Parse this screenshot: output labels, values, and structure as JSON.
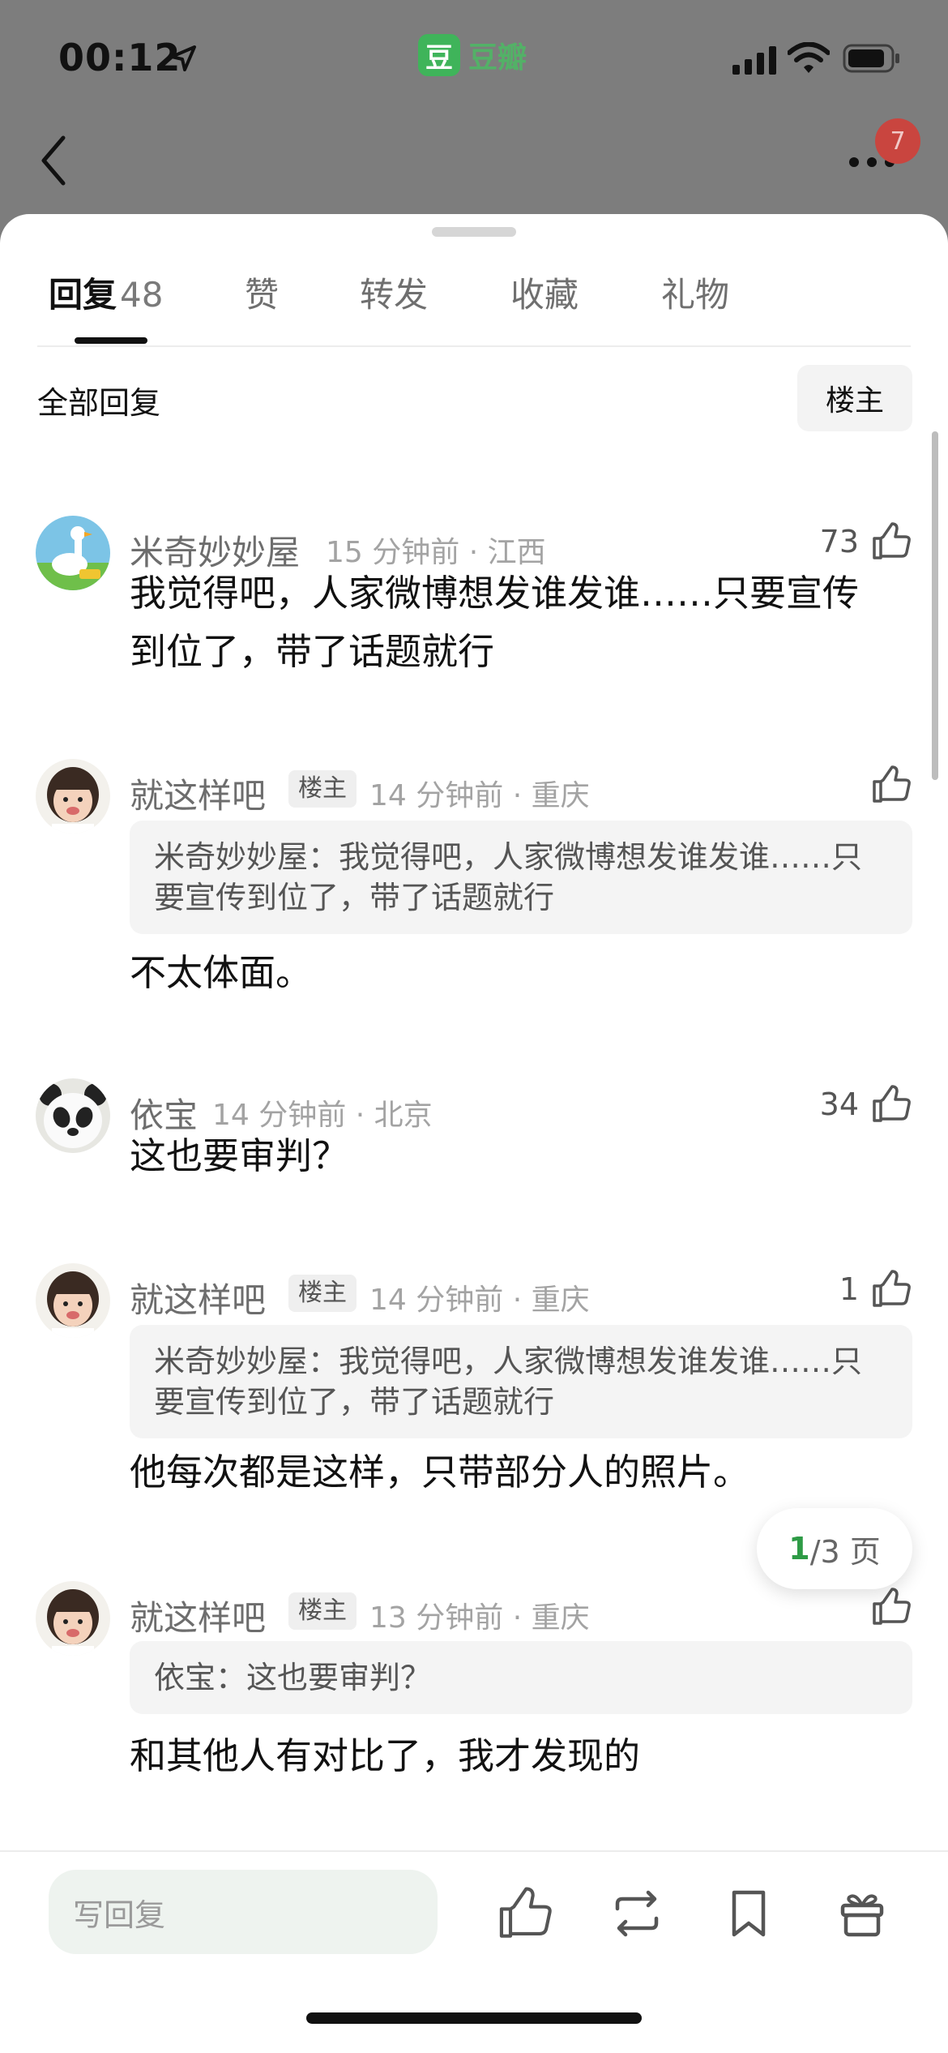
{
  "status": {
    "time": "00:12",
    "app_name": "豆瓣",
    "app_logo_char": "豆"
  },
  "nav": {
    "notification_count": "7"
  },
  "tabs": [
    {
      "label": "回复",
      "count": "48"
    },
    {
      "label": "赞"
    },
    {
      "label": "转发"
    },
    {
      "label": "收藏"
    },
    {
      "label": "礼物"
    }
  ],
  "section": {
    "title": "全部回复",
    "op_filter": "楼主"
  },
  "comments": [
    {
      "user": "米奇妙妙屋",
      "meta": "15 分钟前 · 江西",
      "likes": "73",
      "text_lines": [
        "我觉得吧，人家微博想发谁发谁……只要宣传",
        "到位了，带了话题就行"
      ]
    },
    {
      "user": "就这样吧",
      "tag": "楼主",
      "meta": "14 分钟前 · 重庆",
      "likes": "",
      "quote_lines": [
        "米奇妙妙屋：我觉得吧，人家微博想发谁发谁……只",
        "要宣传到位了，带了话题就行"
      ],
      "text": "不太体面。"
    },
    {
      "user": "依宝",
      "meta": "14 分钟前 · 北京",
      "likes": "34",
      "text": "这也要审判？"
    },
    {
      "user": "就这样吧",
      "tag": "楼主",
      "meta": "14 分钟前 · 重庆",
      "likes": "1",
      "quote_lines": [
        "米奇妙妙屋：我觉得吧，人家微博想发谁发谁……只",
        "要宣传到位了，带了话题就行"
      ],
      "text": "他每次都是这样，只带部分人的照片。"
    },
    {
      "user": "就这样吧",
      "tag": "楼主",
      "meta": "13 分钟前 · 重庆",
      "likes": "",
      "quote": "依宝：这也要审判？",
      "text": "和其他人有对比了，我才发现的"
    }
  ],
  "pagination": {
    "current": "1",
    "total": "/3 页"
  },
  "bottom_bar": {
    "reply_placeholder": "写回复"
  },
  "icons": [
    "location-arrow-icon",
    "signal-icon",
    "wifi-icon",
    "battery-icon",
    "back-chevron-icon",
    "more-icon",
    "thumbs-up-icon",
    "repost-icon",
    "bookmark-icon",
    "gift-icon"
  ],
  "colors": {
    "accent": "#2e9b46",
    "badge": "#c9453f",
    "background_overlay": "#7d7d7d"
  }
}
